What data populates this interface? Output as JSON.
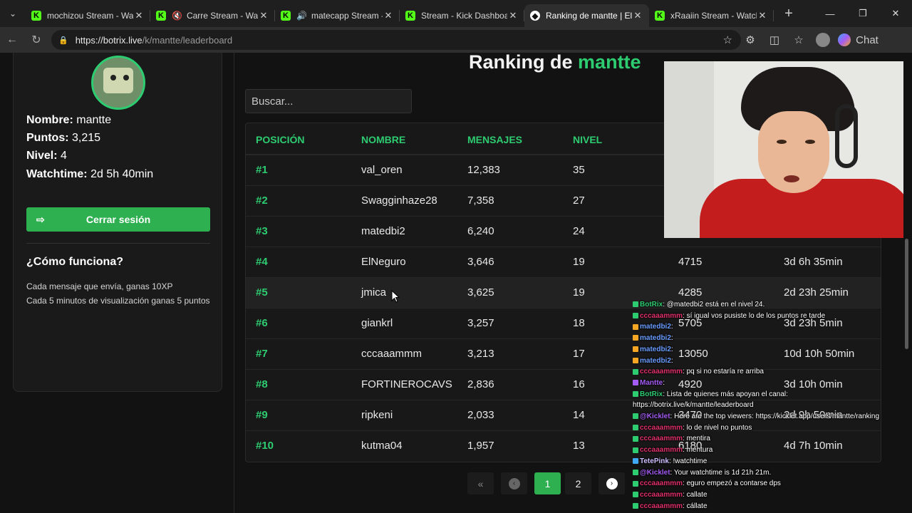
{
  "browser": {
    "tabs": [
      {
        "title": "mochizou Stream - Watc",
        "icon": "kick",
        "muted": false
      },
      {
        "title": "Carre Stream - Wat",
        "icon": "kick",
        "muted": true
      },
      {
        "title": "matecapp Stream -",
        "icon": "kick",
        "speaker": true
      },
      {
        "title": "Stream - Kick Dashboard",
        "icon": "kick"
      },
      {
        "title": "Ranking de mantte | El r",
        "icon": "botrix",
        "active": true
      },
      {
        "title": "xRaaiin Stream - Watch",
        "icon": "kick"
      }
    ],
    "url_host": "https://botrix.live",
    "url_path": "/k/mantte/leaderboard",
    "chat_label": "Chat"
  },
  "profile": {
    "name_label": "Nombre:",
    "name": "mantte",
    "points_label": "Puntos:",
    "points": "3,215",
    "level_label": "Nivel:",
    "level": "4",
    "watchtime_label": "Watchtime:",
    "watchtime": "2d 5h 40min",
    "logout_label": "Cerrar sesión"
  },
  "how": {
    "title": "¿Cómo funciona?",
    "line1": "Cada mensaje que envía, ganas 10XP",
    "line2": "Cada 5 minutos de visualización ganas 5 puntos"
  },
  "ranking": {
    "title_prefix": "Ranking de",
    "title_name": "mantte",
    "search_placeholder": "Buscar...",
    "headers": [
      "POSICIÓN",
      "NOMBRE",
      "MENSAJES",
      "NIVEL"
    ],
    "rows": [
      {
        "pos": "#1",
        "name": "val_oren",
        "messages": "12,383",
        "level": "35",
        "points": "",
        "watch": ""
      },
      {
        "pos": "#2",
        "name": "Swagginhaze28",
        "messages": "7,358",
        "level": "27",
        "points": "",
        "watch": ""
      },
      {
        "pos": "#3",
        "name": "matedbi2",
        "messages": "6,240",
        "level": "24",
        "points": "",
        "watch": ""
      },
      {
        "pos": "#4",
        "name": "ElNeguro",
        "messages": "3,646",
        "level": "19",
        "points": "4715",
        "watch": "3d 6h 35min"
      },
      {
        "pos": "#5",
        "name": "jmica",
        "messages": "3,625",
        "level": "19",
        "points": "4285",
        "watch": "2d 23h 25min"
      },
      {
        "pos": "#6",
        "name": "giankrl",
        "messages": "3,257",
        "level": "18",
        "points": "5705",
        "watch": "3d 23h 5min"
      },
      {
        "pos": "#7",
        "name": "cccaaammm",
        "messages": "3,213",
        "level": "17",
        "points": "13050",
        "watch": "10d 10h 50min"
      },
      {
        "pos": "#8",
        "name": "FORTINEROCAVS",
        "messages": "2,836",
        "level": "16",
        "points": "4920",
        "watch": "3d 10h 0min"
      },
      {
        "pos": "#9",
        "name": "ripkeni",
        "messages": "2,033",
        "level": "14",
        "points": "3470",
        "watch": "2d 9h 50min"
      },
      {
        "pos": "#10",
        "name": "kutma04",
        "messages": "1,957",
        "level": "13",
        "points": "6180",
        "watch": "4d 7h 10min"
      }
    ],
    "pages": [
      "1",
      "2"
    ],
    "current_page": "1"
  },
  "chat": [
    {
      "user": "BotRix",
      "text": ": @matedbi2 está en el nivel 24."
    },
    {
      "user": "cccaaammm",
      "text": ": sí igual vos pusiste lo de los puntos re tarde"
    },
    {
      "user": "matedbi2",
      "text": ": "
    },
    {
      "user": "matedbi2",
      "text": ": "
    },
    {
      "user": "matedbi2",
      "text": ": "
    },
    {
      "user": "matedbi2",
      "text": ": "
    },
    {
      "user": "cccaaammm",
      "text": ": pq si no estaría re arriba"
    },
    {
      "user": "Mantte",
      "text": ": "
    },
    {
      "user": "BotRix",
      "text": ": Lista de quienes más apoyan el canal:"
    },
    {
      "user": "",
      "text": "https://botrix.live/k/mantte/leaderboard"
    },
    {
      "user": "@Kicklet",
      "text": ": Here are the top viewers: https://kicklet.app/users/mantte/ranking"
    },
    {
      "user": "cccaaammm",
      "text": ": lo de nivel no puntos"
    },
    {
      "user": "cccaaammm",
      "text": ": mentira"
    },
    {
      "user": "cccaaammm",
      "text": ": mentura"
    },
    {
      "user": "TetePink",
      "text": ": !watchtime"
    },
    {
      "user": "@Kicklet",
      "text": ": Your watchtime is 1d 21h 21m."
    },
    {
      "user": "cccaaammm",
      "text": ": eguro empezó a contarse dps"
    },
    {
      "user": "cccaaammm",
      "text": ": callate"
    },
    {
      "user": "cccaaammm",
      "text": ": cállate"
    }
  ]
}
